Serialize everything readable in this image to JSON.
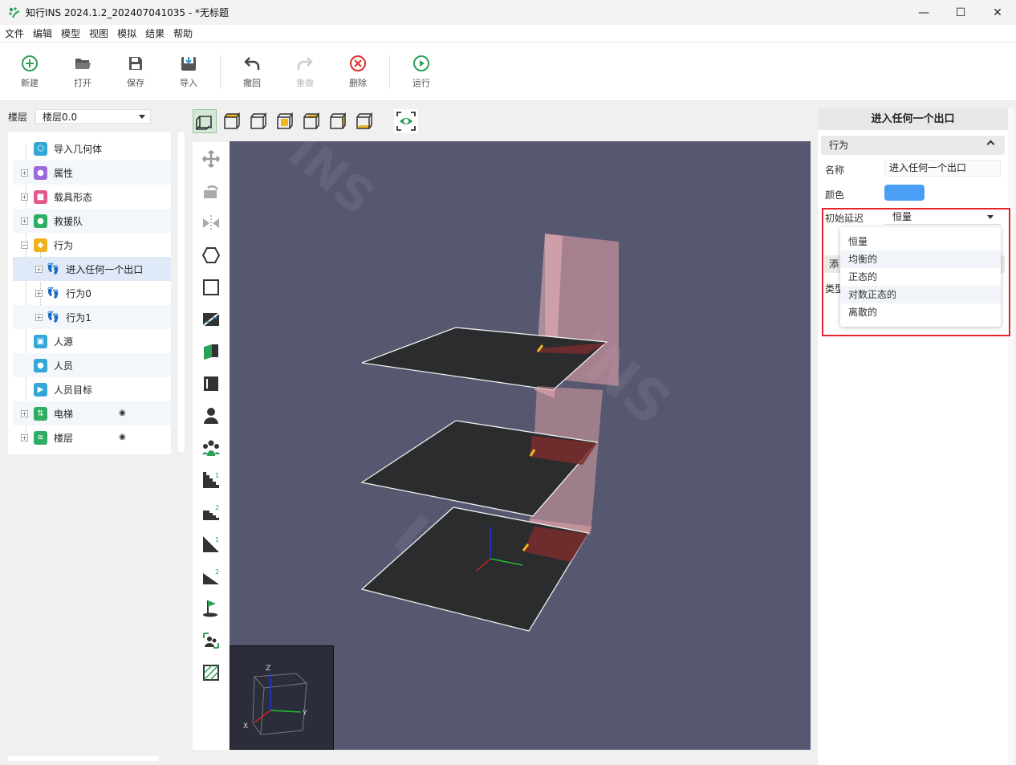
{
  "window": {
    "title": "知行INS 2024.1.2_202407041035 - *无标题",
    "controls": {
      "minimize": "—",
      "maximize": "☐",
      "close": "✕"
    }
  },
  "menu": [
    "文件",
    "编辑",
    "模型",
    "视图",
    "模拟",
    "结果",
    "帮助"
  ],
  "toolbar": {
    "new": "新建",
    "open": "打开",
    "save": "保存",
    "import": "导入",
    "undo": "撤回",
    "redo": "重做",
    "delete": "删除",
    "run": "运行"
  },
  "floor_selector": {
    "label": "楼层",
    "value": "楼层0.0"
  },
  "tree": {
    "import_geometry": "导入几何体",
    "attributes": "属性",
    "vehicle_form": "载具形态",
    "rescue_team": "救援队",
    "behavior": "行为",
    "behavior_children": [
      "进入任何一个出口",
      "行为0",
      "行为1"
    ],
    "people_source": "人源",
    "people": "人员",
    "people_target": "人员目标",
    "elevator": "电梯",
    "floors": "楼层"
  },
  "viewport_axes": {
    "z": "Z",
    "x": "X",
    "y": "Y"
  },
  "right_panel": {
    "title": "进入任何一个出口",
    "section": "行为",
    "name_label": "名称",
    "name_value": "进入任何一个出口",
    "color_label": "颜色",
    "color_value": "#4a9ef6",
    "delay_label": "初始延迟",
    "delay_value": "恒量",
    "hidden_add": "添",
    "hidden_type": "类型",
    "dropdown_options": [
      "恒量",
      "均衡的",
      "正态的",
      "对数正态的",
      "离散的"
    ]
  },
  "colors": {
    "accent_green": "#2e9e58",
    "viewport_bg": "#565870",
    "highlight_red": "#e3262c"
  }
}
